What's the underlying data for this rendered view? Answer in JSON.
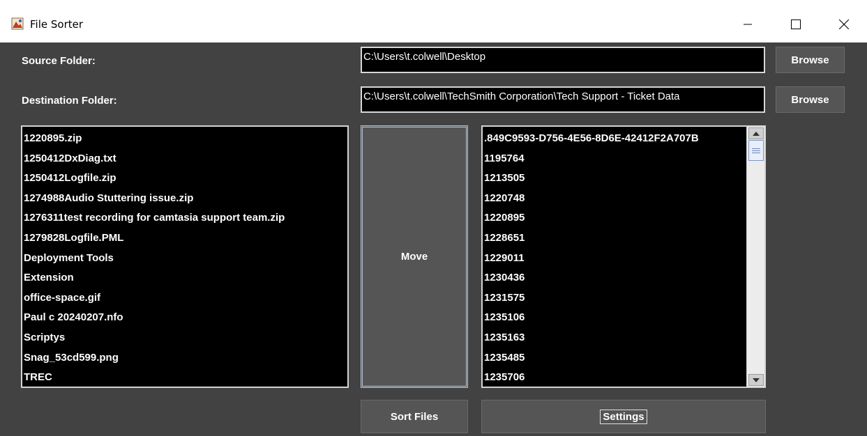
{
  "window": {
    "title": "File Sorter",
    "controls": {
      "minimize": "minimize-icon",
      "maximize": "maximize-icon",
      "close": "close-icon"
    }
  },
  "source": {
    "label": "Source Folder:",
    "path": "C:\\Users\\t.colwell\\Desktop",
    "browse_label": "Browse"
  },
  "destination": {
    "label": "Destination Folder:",
    "path": "C:\\Users\\t.colwell\\TechSmith Corporation\\Tech Support - Ticket Data",
    "browse_label": "Browse"
  },
  "source_files": [
    "1220895.zip",
    "1250412DxDiag.txt",
    "1250412Logfile.zip",
    "1274988Audio Stuttering issue.zip",
    "1276311test recording for camtasia support team.zip",
    "1279828Logfile.PML",
    "Deployment Tools",
    "Extension",
    "office-space.gif",
    "Paul c 20240207.nfo",
    "Scriptys",
    "Snag_53cd599.png",
    "TREC"
  ],
  "destination_folders": [
    ".849C9593-D756-4E56-8D6E-42412F2A707B",
    "1195764",
    "1213505",
    "1220748",
    "1220895",
    "1228651",
    "1229011",
    "1230436",
    "1231575",
    "1235106",
    "1235163",
    "1235485",
    "1235706"
  ],
  "actions": {
    "move_label": "Move",
    "sort_label": "Sort Files",
    "settings_label": "Settings"
  },
  "colors": {
    "panel_bg": "#424242",
    "field_bg": "#000000",
    "button_bg": "#555555",
    "text": "#ffffff"
  }
}
